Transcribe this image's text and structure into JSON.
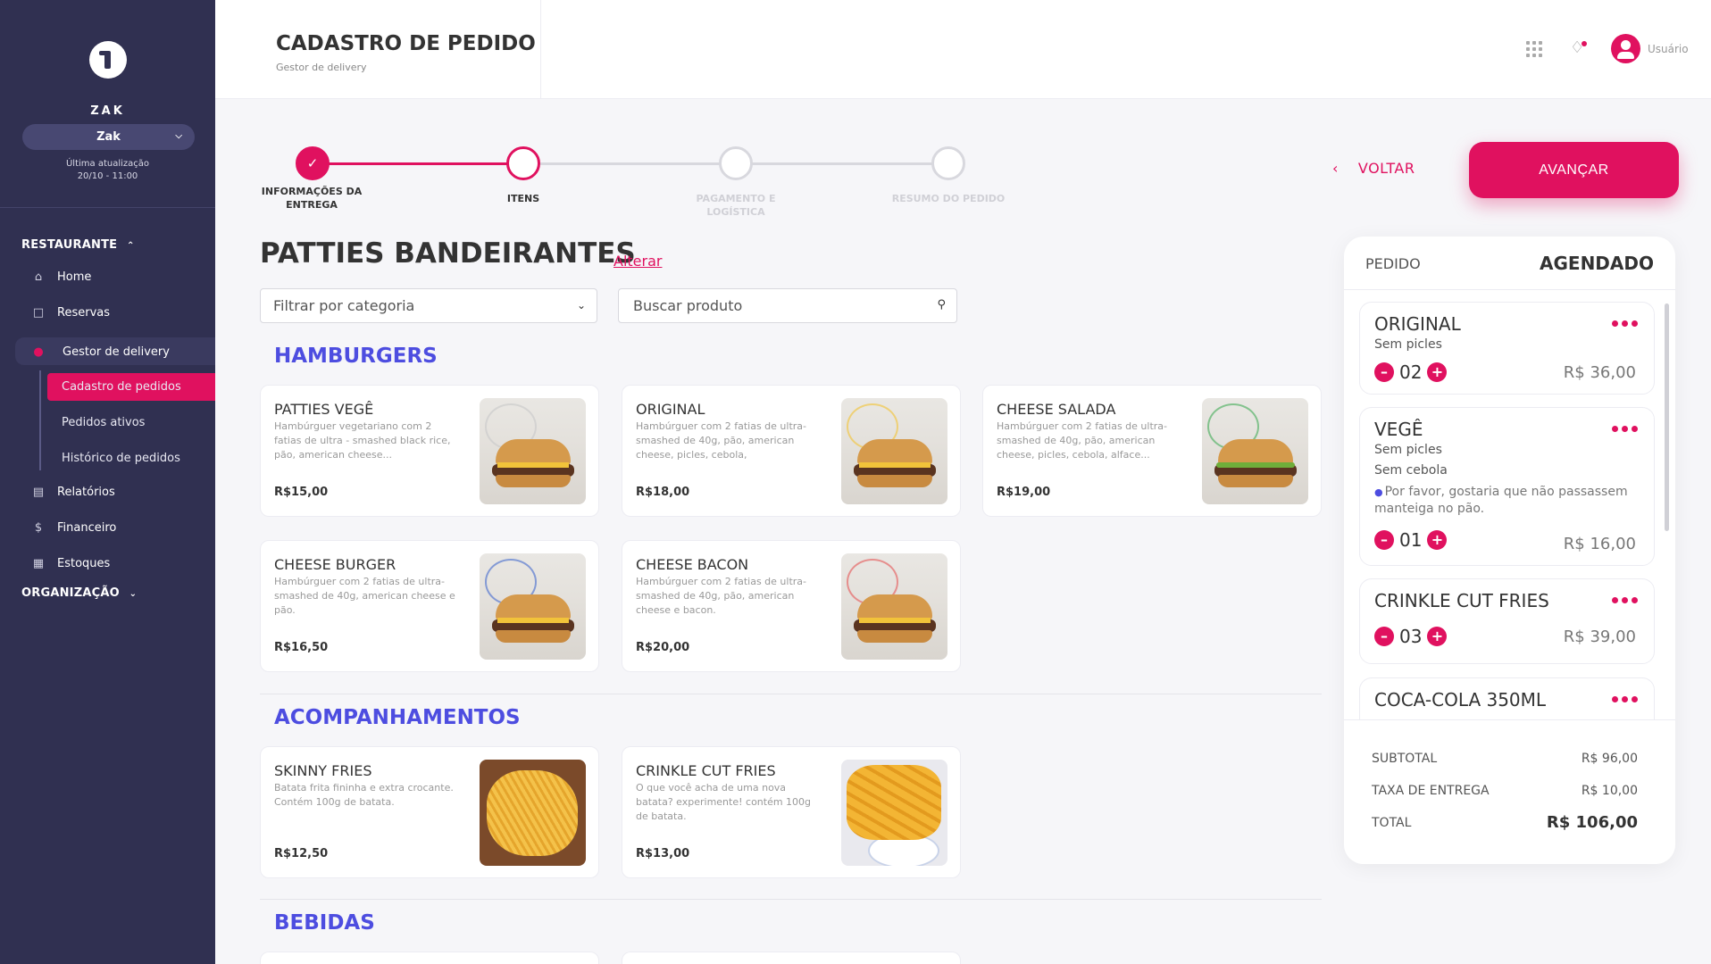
{
  "sidebar": {
    "brand": "ZAK",
    "store": "Zak",
    "update_label": "Última atualização",
    "update_time": "20/10 - 11:00",
    "section_restaurante": "RESTAURANTE",
    "items": [
      {
        "label": "Home",
        "icon": "home-icon"
      },
      {
        "label": "Reservas",
        "icon": "bookmark-icon"
      },
      {
        "label": "Gestor de delivery",
        "icon": "motorcycle-icon"
      },
      {
        "label": "Relatórios",
        "icon": "document-icon"
      },
      {
        "label": "Financeiro",
        "icon": "dollar-icon"
      },
      {
        "label": "Estoques",
        "icon": "grid-icon"
      }
    ],
    "subitems": [
      "Cadastro de pedidos",
      "Pedidos ativos",
      "Histórico de pedidos"
    ],
    "section_organizacao": "ORGANIZAÇÃO"
  },
  "header": {
    "title": "CADASTRO DE PEDIDO",
    "subtitle": "Gestor de delivery",
    "user": "Usuário"
  },
  "stepper": {
    "steps": [
      "INFORMAÇÕES DA ENTREGA",
      "ITENS",
      "PAGAMENTO E LOGÍSTICA",
      "RESUMO DO PEDIDO"
    ],
    "back": "VOLTAR",
    "next": "AVANÇAR"
  },
  "store": {
    "name": "PATTIES BANDEIRANTES",
    "change": "Alterar"
  },
  "filter": {
    "category_placeholder": "Filtrar por categoria",
    "search_placeholder": "Buscar produto"
  },
  "categories": [
    {
      "title": "HAMBURGERS",
      "products": [
        {
          "name": "PATTIES VEGÊ",
          "desc": "Hambúrguer vegetariano com 2 fatias de ultra - smashed black rice, pão, american cheese...",
          "price": "R$15,00"
        },
        {
          "name": "ORIGINAL",
          "desc": "Hambúrguer com 2 fatias de ultra-smashed de 40g, pão, american cheese, picles, cebola,",
          "price": "R$18,00"
        },
        {
          "name": "CHEESE SALADA",
          "desc": "Hambúrguer com 2 fatias de ultra-smashed de 40g, pão, american cheese, picles, cebola, alface...",
          "price": "R$19,00"
        },
        {
          "name": "CHEESE BURGER",
          "desc": "Hambúrguer com 2 fatias de ultra-smashed de 40g, american cheese e pão.",
          "price": "R$16,50"
        },
        {
          "name": "CHEESE BACON",
          "desc": "Hambúrguer com 2 fatias de ultra-smashed de 40g, pão, american cheese e bacon.",
          "price": "R$20,00"
        }
      ]
    },
    {
      "title": "ACOMPANHAMENTOS",
      "products": [
        {
          "name": "SKINNY FRIES",
          "desc": "Batata frita fininha e extra crocante. Contém 100g de batata.",
          "price": "R$12,50"
        },
        {
          "name": "CRINKLE CUT FRIES",
          "desc": "O que você acha de uma nova batata? experimente! contém 100g de batata.",
          "price": "R$13,00"
        }
      ]
    },
    {
      "title": "BEBIDAS",
      "products": []
    }
  ],
  "order": {
    "label": "PEDIDO",
    "status": "AGENDADO",
    "items": [
      {
        "name": "ORIGINAL",
        "options": [
          "Sem picles"
        ],
        "note": "",
        "qty": "02",
        "price": "R$ 36,00"
      },
      {
        "name": "VEGÊ",
        "options": [
          "Sem picles",
          "Sem cebola"
        ],
        "note": "Por favor, gostaria que não passassem manteiga no pão.",
        "qty": "01",
        "price": "R$ 16,00"
      },
      {
        "name": "CRINKLE CUT FRIES",
        "options": [],
        "note": "",
        "qty": "03",
        "price": "R$ 39,00"
      },
      {
        "name": "COCA-COLA 350ML",
        "options": [],
        "note": "",
        "qty": "",
        "price": ""
      }
    ],
    "subtotal_label": "SUBTOTAL",
    "subtotal": "R$ 96,00",
    "delivery_label": "TAXA DE ENTREGA",
    "delivery": "R$ 10,00",
    "total_label": "TOTAL",
    "total": "R$ 106,00"
  },
  "colors": {
    "accent": "#e0115f",
    "category": "#4d4de0",
    "sidebar": "#303051"
  }
}
